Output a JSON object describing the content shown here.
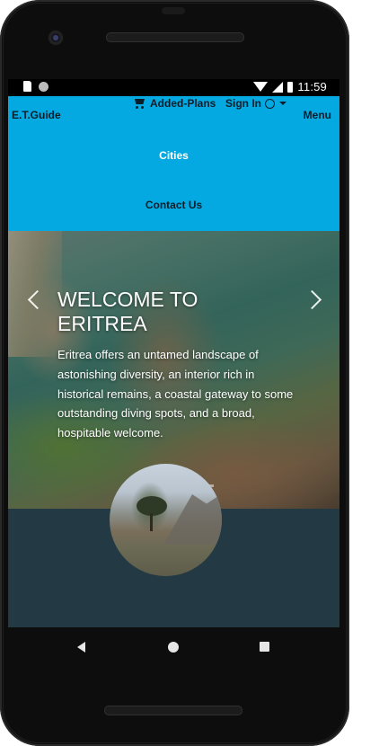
{
  "status_bar": {
    "time": "11:59",
    "icons": [
      "sd-card-icon",
      "notification-dot-icon",
      "wifi-icon",
      "signal-icon",
      "battery-icon"
    ]
  },
  "navbar": {
    "brand": "E.T.Guide",
    "added_plans": "Added-Plans",
    "sign_in": "Sign In",
    "menu": "Menu",
    "items": [
      {
        "label": "Cities"
      },
      {
        "label": "Contact Us"
      }
    ],
    "colors": {
      "background": "#03a9e0",
      "active_item": "#ffffff",
      "text": "#0c1d2a"
    }
  },
  "hero": {
    "title_line1": "WELCOME TO",
    "title_line2": "ERITREA",
    "text": "Eritrea offers an untamed landscape of astonishing diversity, an interior rich in historical remains, a coastal gateway to some outstanding diving spots, and a broad, hospitable welcome.",
    "slide_count": 3,
    "active_slide": 1
  },
  "section": {
    "background": "#233a44"
  },
  "system_nav": {
    "buttons": [
      "back-icon",
      "home-icon",
      "recents-icon"
    ]
  }
}
